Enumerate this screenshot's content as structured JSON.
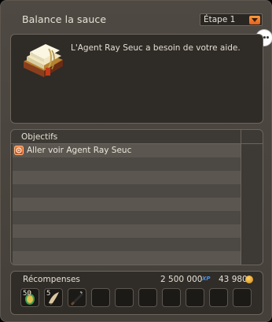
{
  "window": {
    "title": "Balance la sauce"
  },
  "stage_select": {
    "value": "Étape 1",
    "arrow_icon": "chevron-down-icon"
  },
  "chat_icon": "speech-bubble-icon",
  "description": {
    "icon": "quest-scroll-icon",
    "text": "L'Agent Ray Seuc a besoin de votre aide."
  },
  "objectives": {
    "header": "Objectifs",
    "items": [
      {
        "text": "Aller voir Agent Ray Seuc",
        "icon": "objective-target-icon"
      }
    ]
  },
  "rewards": {
    "title": "Récompenses",
    "xp": "2 500 000",
    "xp_icon_label": "XP",
    "kamas": "43 980",
    "kamas_icon": "kama-coin-icon",
    "items": [
      {
        "qty": "50",
        "icon": "potion-icon"
      },
      {
        "qty": "5",
        "icon": "horn-icon"
      },
      {
        "qty": "",
        "icon": "rifle-icon"
      },
      {
        "qty": "",
        "icon": "empty-slot"
      },
      {
        "qty": "",
        "icon": "empty-slot"
      },
      {
        "qty": "",
        "icon": "empty-slot"
      },
      {
        "qty": "",
        "icon": "empty-slot"
      },
      {
        "qty": "",
        "icon": "empty-slot"
      },
      {
        "qty": "",
        "icon": "empty-slot"
      },
      {
        "qty": "",
        "icon": "empty-slot"
      }
    ]
  },
  "colors": {
    "accent_orange": "#f07c2e",
    "window_bg": "#4a453f",
    "panel_bg": "#2f2b27",
    "row_light": "#5b5650",
    "row_dark": "#4c4843",
    "xp_blue": "#4a8fe0",
    "kama_gold": "#e7a82a"
  }
}
